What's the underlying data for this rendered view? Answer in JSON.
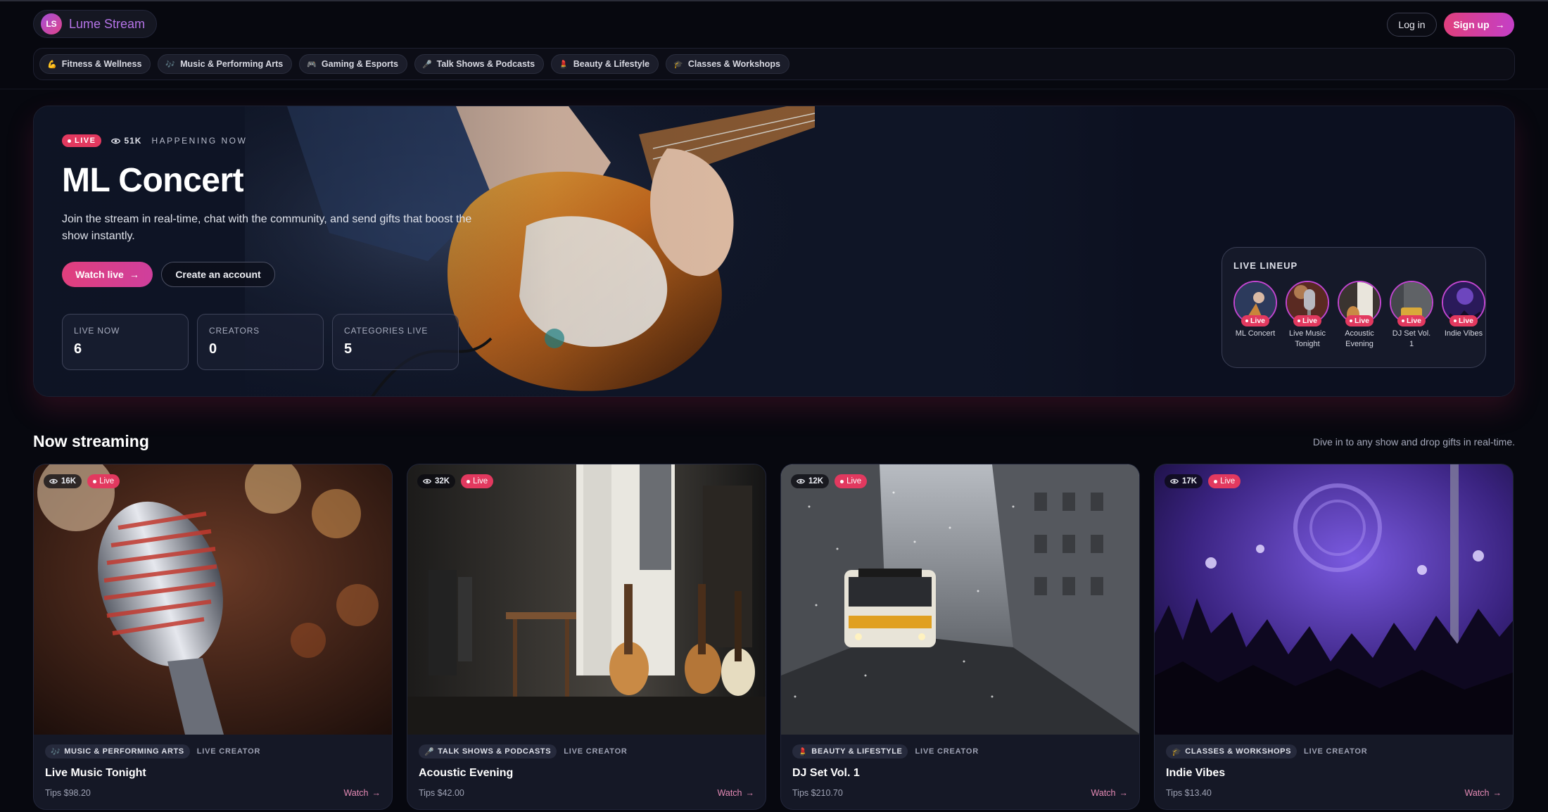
{
  "brand": {
    "initials": "LS",
    "name": "Lume Stream"
  },
  "header": {
    "login_label": "Log in",
    "signup_label": "Sign up",
    "signup_arrow": "→"
  },
  "categories": [
    {
      "label": "Fitness & Wellness",
      "icon": "muscle-icon",
      "glyph": "💪"
    },
    {
      "label": "Music & Performing Arts",
      "icon": "music-icon",
      "glyph": "🎶"
    },
    {
      "label": "Gaming & Esports",
      "icon": "gamepad-icon",
      "glyph": "🎮"
    },
    {
      "label": "Talk Shows & Podcasts",
      "icon": "microphone-icon",
      "glyph": "🎤"
    },
    {
      "label": "Beauty & Lifestyle",
      "icon": "lipstick-icon",
      "glyph": "💄"
    },
    {
      "label": "Classes & Workshops",
      "icon": "graduation-cap-icon",
      "glyph": "🎓"
    }
  ],
  "hero": {
    "live_label": "LIVE",
    "viewers": "51K",
    "happening": "HAPPENING NOW",
    "title": "ML Concert",
    "description": "Join the stream in real-time, chat with the community, and send gifts that boost the show instantly.",
    "watch_label": "Watch live",
    "watch_arrow": "→",
    "create_label": "Create an account",
    "stats": [
      {
        "label": "LIVE NOW",
        "value": "6"
      },
      {
        "label": "CREATORS",
        "value": "0"
      },
      {
        "label": "CATEGORIES LIVE",
        "value": "5"
      }
    ]
  },
  "lineup": {
    "title": "LIVE LINEUP",
    "badge": "Live",
    "items": [
      {
        "label": "ML Concert"
      },
      {
        "label": "Live Music Tonight"
      },
      {
        "label": "Acoustic Evening"
      },
      {
        "label": "DJ Set Vol. 1"
      },
      {
        "label": "Indie Vibes"
      }
    ]
  },
  "section": {
    "title": "Now streaming",
    "subtitle": "Dive in to any show and drop gifts in real-time."
  },
  "cards": [
    {
      "viewers": "16K",
      "live": "Live",
      "category": "MUSIC & PERFORMING ARTS",
      "creator": "LIVE CREATOR",
      "title": "Live Music Tonight",
      "tips": "Tips $98.20",
      "watch": "Watch"
    },
    {
      "viewers": "32K",
      "live": "Live",
      "category": "TALK SHOWS & PODCASTS",
      "creator": "LIVE CREATOR",
      "title": "Acoustic Evening",
      "tips": "Tips $42.00",
      "watch": "Watch"
    },
    {
      "viewers": "12K",
      "live": "Live",
      "category": "BEAUTY & LIFESTYLE",
      "creator": "LIVE CREATOR",
      "title": "DJ Set Vol. 1",
      "tips": "Tips $210.70",
      "watch": "Watch"
    },
    {
      "viewers": "17K",
      "live": "Live",
      "category": "CLASSES & WORKSHOPS",
      "creator": "LIVE CREATOR",
      "title": "Indie Vibes",
      "tips": "Tips $13.40",
      "watch": "Watch"
    }
  ],
  "colors": {
    "accent": "#e03f7d",
    "brand": "#b473e6",
    "live": "#e2395f",
    "background": "#07080f"
  }
}
